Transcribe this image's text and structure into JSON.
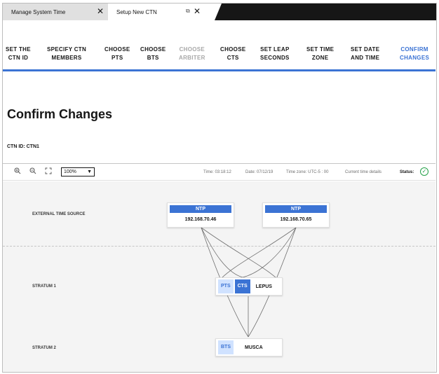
{
  "tabs": [
    {
      "label": "Manage System Time"
    },
    {
      "label": "Setup New CTN"
    }
  ],
  "steps": [
    {
      "label_1": "SET THE",
      "label_2": "CTN ID"
    },
    {
      "label_1": "SPECIFY CTN",
      "label_2": "MEMBERS"
    },
    {
      "label_1": "CHOOSE",
      "label_2": "PTS"
    },
    {
      "label_1": "CHOOSE",
      "label_2": "BTS"
    },
    {
      "label_1": "CHOOSE",
      "label_2": "ARBITER"
    },
    {
      "label_1": "CHOOSE",
      "label_2": "CTS"
    },
    {
      "label_1": "SET LEAP",
      "label_2": "SECONDS"
    },
    {
      "label_1": "SET TIME",
      "label_2": "ZONE"
    },
    {
      "label_1": "SET DATE",
      "label_2": "AND TIME"
    },
    {
      "label_1": "CONFIRM",
      "label_2": "CHANGES"
    }
  ],
  "page": {
    "title": "Confirm Changes",
    "ctn_id": "CTN ID: CTN1"
  },
  "toolbar": {
    "zoom": "100%",
    "time": "Time: 03:18:12",
    "date": "Date: 07/12/19",
    "timezone": "Time zone: UTC-5 : 00",
    "details_link": "Current time details",
    "status_label": "Status:",
    "status_color": "#24a148"
  },
  "topology": {
    "rows": {
      "external": "EXTERNAL TIME SOURCE",
      "stratum1": "STRATUM 1",
      "stratum2": "STRATUM 2"
    },
    "ntp_nodes": [
      {
        "header": "NTP",
        "ip": "192.168.70.46"
      },
      {
        "header": "NTP",
        "ip": "192.168.70.65"
      }
    ],
    "stratum1_node": {
      "role_1": "PTS",
      "role_2": "CTS",
      "name": "LEPUS"
    },
    "stratum2_node": {
      "role_1": "BTS",
      "name": "MUSCA"
    }
  },
  "colors": {
    "accent": "#3b73d4",
    "accent_light": "#d0e2ff"
  }
}
